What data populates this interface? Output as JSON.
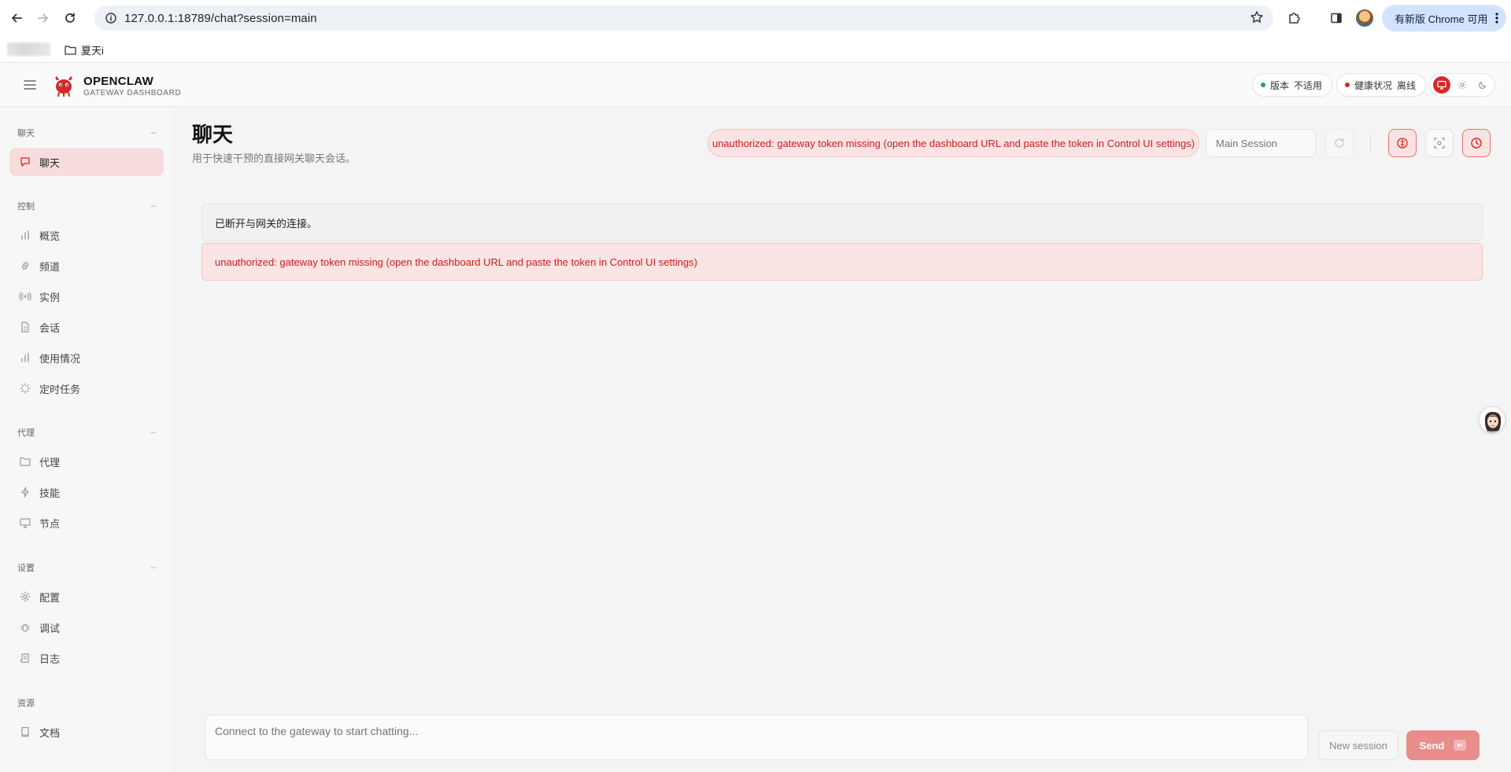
{
  "browser": {
    "url": "127.0.0.1:18789/chat?session=main",
    "update_label": "有新版 Chrome 可用",
    "bookmark_folder": "夏天i"
  },
  "header": {
    "brand_title": "OPENCLAW",
    "brand_subtitle": "GATEWAY DASHBOARD",
    "version_label": "版本",
    "version_value": "不适用",
    "health_label": "健康状况",
    "health_value": "离线"
  },
  "sidebar": {
    "sections": [
      {
        "title": "聊天",
        "items": [
          {
            "label": "聊天",
            "icon": "chat-bubble-icon",
            "active": true
          }
        ]
      },
      {
        "title": "控制",
        "items": [
          {
            "label": "概览",
            "icon": "bar-chart-icon"
          },
          {
            "label": "频道",
            "icon": "link-icon"
          },
          {
            "label": "实例",
            "icon": "broadcast-icon"
          },
          {
            "label": "会话",
            "icon": "document-icon"
          },
          {
            "label": "使用情况",
            "icon": "bar-chart-icon"
          },
          {
            "label": "定时任务",
            "icon": "loader-icon"
          }
        ]
      },
      {
        "title": "代理",
        "items": [
          {
            "label": "代理",
            "icon": "folder-icon"
          },
          {
            "label": "技能",
            "icon": "lightning-icon"
          },
          {
            "label": "节点",
            "icon": "monitor-icon"
          }
        ]
      },
      {
        "title": "设置",
        "items": [
          {
            "label": "配置",
            "icon": "gear-icon"
          },
          {
            "label": "调试",
            "icon": "bug-icon"
          },
          {
            "label": "日志",
            "icon": "scroll-icon"
          }
        ]
      },
      {
        "title": "资源",
        "items": [
          {
            "label": "文档",
            "icon": "book-icon"
          }
        ]
      }
    ]
  },
  "main": {
    "title": "聊天",
    "subtitle": "用于快速干预的直接网关聊天会话。",
    "error_pill": "unauthorized: gateway token missing (open the dashboard URL and paste the token in Control UI settings)",
    "session_placeholder": "Main Session",
    "banner_disconnected": "已断开与网关的连接。",
    "banner_error": "unauthorized: gateway token missing (open the dashboard URL and paste the token in Control UI settings)",
    "chat_placeholder": "Connect to the gateway to start chatting...",
    "new_session_label": "New session",
    "send_label": "Send"
  },
  "colors": {
    "accent": "#dc2626",
    "error_bg": "#fbe3e3",
    "status_ok": "#22a84a",
    "status_offline": "#dc2626"
  }
}
